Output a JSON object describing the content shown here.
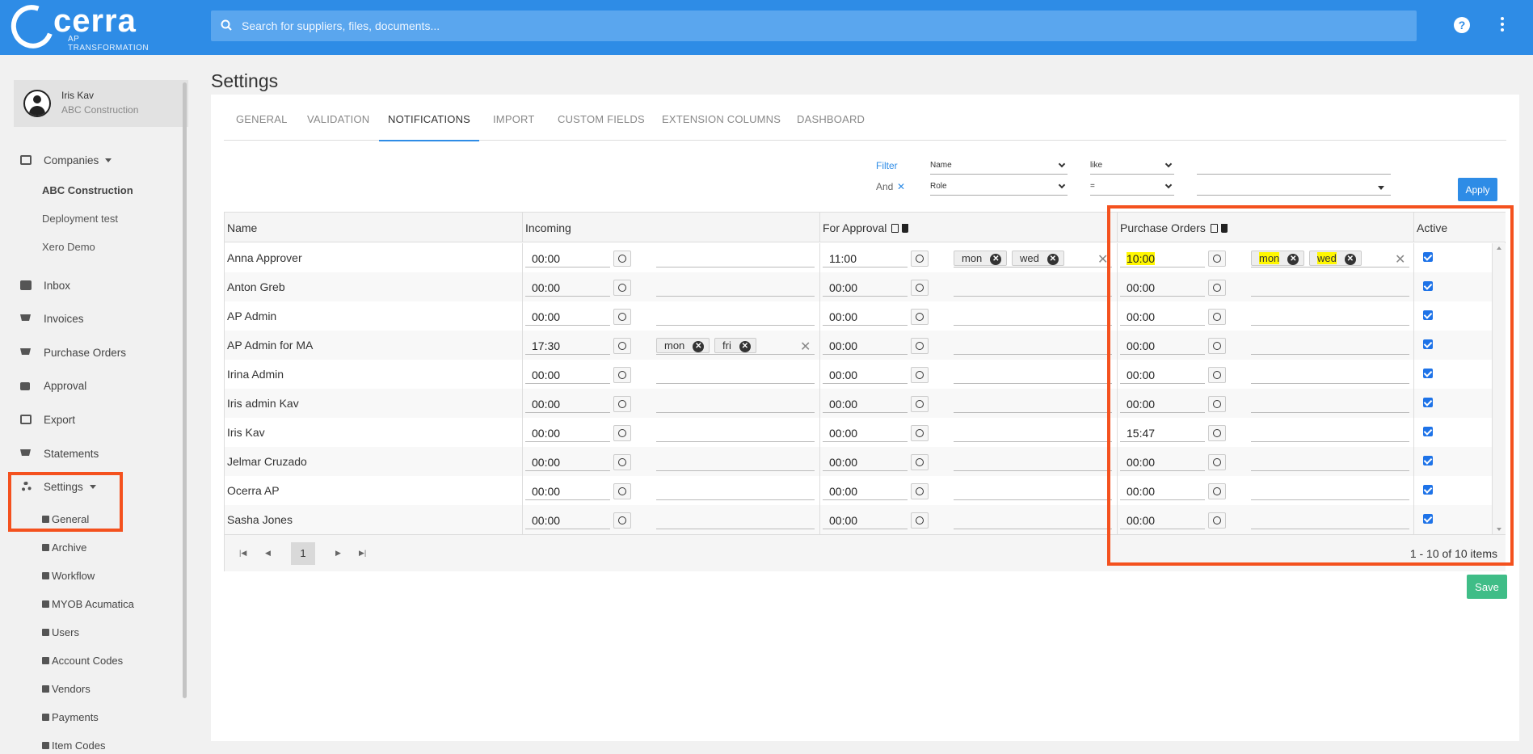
{
  "brand": {
    "name": "cerra",
    "tagline": "AP TRANSFORMATION"
  },
  "search": {
    "placeholder": "Search for suppliers, files, documents..."
  },
  "header": {
    "help_label": "?"
  },
  "user": {
    "name": "Iris Kav",
    "company": "ABC Construction"
  },
  "sidebar": {
    "companies_label": "Companies",
    "companies": [
      "ABC Construction",
      "Deployment test",
      "Xero Demo"
    ],
    "items": [
      {
        "label": "Inbox",
        "icon": "inbox-icon"
      },
      {
        "label": "Invoices",
        "icon": "basket-icon"
      },
      {
        "label": "Purchase Orders",
        "icon": "cart-icon"
      },
      {
        "label": "Approval",
        "icon": "approval-icon"
      },
      {
        "label": "Export",
        "icon": "export-icon"
      },
      {
        "label": "Statements",
        "icon": "basket-icon"
      }
    ],
    "settings_label": "Settings",
    "settings_items": [
      "General",
      "Archive",
      "Workflow",
      "MYOB Acumatica",
      "Users",
      "Account Codes",
      "Vendors",
      "Payments",
      "Item Codes"
    ]
  },
  "page": {
    "title": "Settings"
  },
  "tabs": [
    "GENERAL",
    "VALIDATION",
    "NOTIFICATIONS",
    "IMPORT",
    "CUSTOM FIELDS",
    "EXTENSION COLUMNS",
    "DASHBOARD"
  ],
  "active_tab": "NOTIFICATIONS",
  "filter": {
    "filter_label": "Filter",
    "and_label": "And",
    "and_remove": "✕",
    "row1": {
      "field": "Name",
      "operator": "like",
      "value": ""
    },
    "row2": {
      "field": "Role",
      "operator": "=",
      "value": ""
    },
    "apply_label": "Apply"
  },
  "grid": {
    "columns": [
      "Name",
      "Incoming",
      "For Approval",
      "Purchase Orders",
      "Active"
    ],
    "rows": [
      {
        "name": "Anna Approver",
        "incoming": "00:00",
        "incoming_days": [],
        "approval": "11:00",
        "approval_days": [
          "mon",
          "wed"
        ],
        "po": "10:00",
        "po_days": [
          "mon",
          "wed"
        ],
        "active": true
      },
      {
        "name": "Anton Greb",
        "incoming": "00:00",
        "incoming_days": [],
        "approval": "00:00",
        "approval_days": [],
        "po": "00:00",
        "po_days": [],
        "active": true
      },
      {
        "name": "AP Admin",
        "incoming": "00:00",
        "incoming_days": [],
        "approval": "00:00",
        "approval_days": [],
        "po": "00:00",
        "po_days": [],
        "active": true
      },
      {
        "name": "AP Admin for MA",
        "incoming": "17:30",
        "incoming_days": [
          "mon",
          "fri"
        ],
        "approval": "00:00",
        "approval_days": [],
        "po": "00:00",
        "po_days": [],
        "active": true
      },
      {
        "name": "Irina Admin",
        "incoming": "00:00",
        "incoming_days": [],
        "approval": "00:00",
        "approval_days": [],
        "po": "00:00",
        "po_days": [],
        "active": true
      },
      {
        "name": "Iris admin Kav",
        "incoming": "00:00",
        "incoming_days": [],
        "approval": "00:00",
        "approval_days": [],
        "po": "00:00",
        "po_days": [],
        "active": true
      },
      {
        "name": "Iris Kav",
        "incoming": "00:00",
        "incoming_days": [],
        "approval": "00:00",
        "approval_days": [],
        "po": "15:47",
        "po_days": [],
        "active": true
      },
      {
        "name": "Jelmar Cruzado",
        "incoming": "00:00",
        "incoming_days": [],
        "approval": "00:00",
        "approval_days": [],
        "po": "00:00",
        "po_days": [],
        "active": true
      },
      {
        "name": "Ocerra AP",
        "incoming": "00:00",
        "incoming_days": [],
        "approval": "00:00",
        "approval_days": [],
        "po": "00:00",
        "po_days": [],
        "active": true
      },
      {
        "name": "Sasha Jones",
        "incoming": "00:00",
        "incoming_days": [],
        "approval": "00:00",
        "approval_days": [],
        "po": "00:00",
        "po_days": [],
        "active": true
      }
    ]
  },
  "pager": {
    "page": "1",
    "info": "1 - 10 of 10 items"
  },
  "save_label": "Save",
  "colors": {
    "brand_blue": "#2e8ce6",
    "save_green": "#3fbd87",
    "highlight_orange": "#f4511e",
    "text_highlight": "#fff700"
  }
}
